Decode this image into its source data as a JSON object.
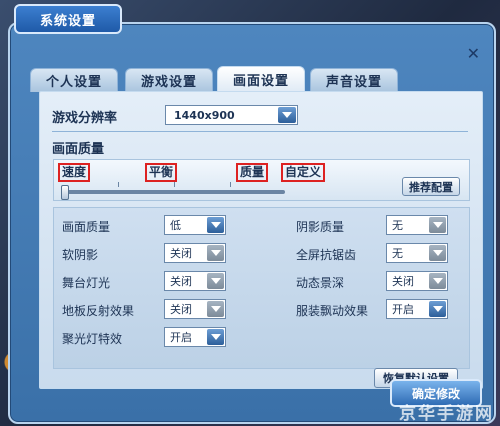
{
  "window": {
    "title": "系统设置"
  },
  "tabs": [
    "个人设置",
    "游戏设置",
    "画面设置",
    "声音设置"
  ],
  "resolution": {
    "label": "游戏分辨率",
    "value": "1440x900"
  },
  "quality": {
    "heading": "画面质量",
    "presets": [
      "速度",
      "平衡",
      "质量",
      "自定义"
    ],
    "recommend_label": "推荐配置",
    "slider_level": 0
  },
  "options": [
    {
      "label": "画面质量",
      "value": "低",
      "enabled": true
    },
    {
      "label": "阴影质量",
      "value": "无",
      "enabled": false
    },
    {
      "label": "软阴影",
      "value": "关闭",
      "enabled": false
    },
    {
      "label": "全屏抗锯齿",
      "value": "无",
      "enabled": false
    },
    {
      "label": "舞台灯光",
      "value": "关闭",
      "enabled": false
    },
    {
      "label": "动态景深",
      "value": "关闭",
      "enabled": false
    },
    {
      "label": "地板反射效果",
      "value": "关闭",
      "enabled": false
    },
    {
      "label": "服装飘动效果",
      "value": "开启",
      "enabled": true
    },
    {
      "label": "聚光灯特效",
      "value": "开启",
      "enabled": true
    }
  ],
  "restore_label": "恢复默认设置",
  "confirm_label": "确定修改",
  "watermark": "京华手游网"
}
